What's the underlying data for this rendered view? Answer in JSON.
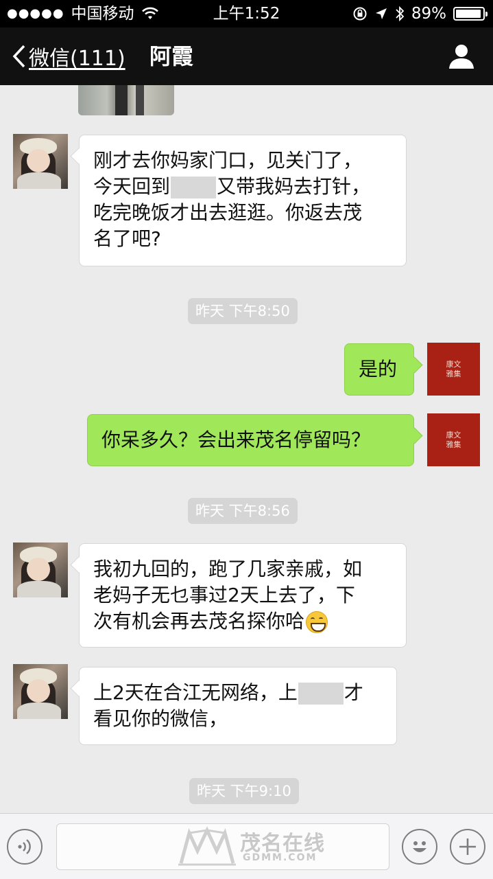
{
  "status_bar": {
    "signal": "●●●●●",
    "carrier": "中国移动",
    "time": "上午1:52",
    "battery": "89%"
  },
  "nav": {
    "back_label": "微信(111)",
    "title": "阿霞"
  },
  "messages": [
    {
      "type": "left",
      "text_1": "刚才去你妈家门口，见关门了，",
      "text_2a": "今天回到",
      "text_2b": "又带我妈去打针，",
      "text_3": "吃完晚饭才出去逛逛。你返去茂",
      "text_4": "名了吧?"
    },
    {
      "type": "time",
      "text": "昨天 下午8:50"
    },
    {
      "type": "right",
      "text": "是的"
    },
    {
      "type": "right",
      "text": "你呆多久？会出来茂名停留吗？"
    },
    {
      "type": "time",
      "text": "昨天 下午8:56"
    },
    {
      "type": "left",
      "text_1": "我初九回的，跑了几家亲戚，如",
      "text_2": "老妈子无乜事过2天上去了，下",
      "text_3": "次有机会再去茂名探你哈"
    },
    {
      "type": "left",
      "text_1a": "上2天在合江无网络，上",
      "text_1b": "才",
      "text_2": "看见你的微信，"
    },
    {
      "type": "time",
      "text": "昨天 下午9:10"
    }
  ],
  "avatar_me_text": "康\n文\n雅\n集",
  "watermark": {
    "text": "茂名在线",
    "sub": "GDMM.COM"
  },
  "icons": [
    "wifi-icon",
    "lock-rotation-icon",
    "location-icon",
    "bluetooth-icon",
    "battery-icon",
    "back-chevron-icon",
    "profile-icon",
    "voice-icon",
    "emoji-icon",
    "plus-icon"
  ]
}
